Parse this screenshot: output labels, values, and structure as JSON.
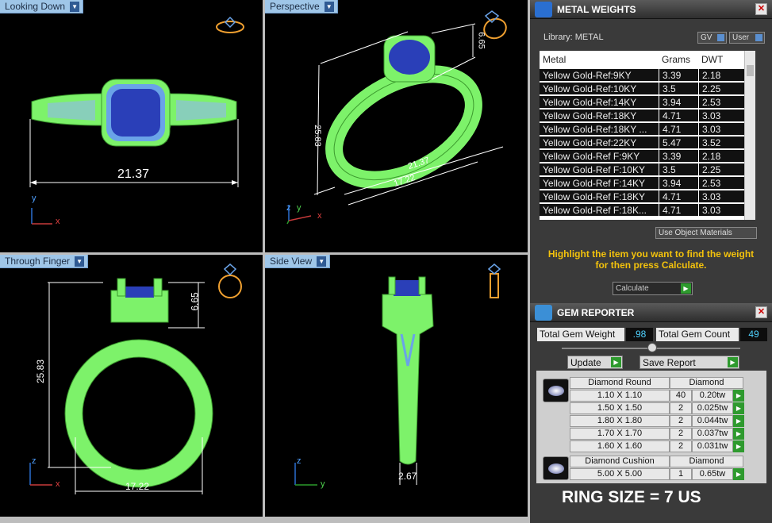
{
  "viewports": {
    "top_left": {
      "title": "Looking Down",
      "dim": "21.37",
      "axis_a": "y",
      "axis_b": "x"
    },
    "top_right": {
      "title": "Perspective",
      "dim_height": "6.65",
      "dim_side": "25.83",
      "dim_width": "21.37",
      "dim_bottom": "17.22",
      "axis_a": "z",
      "axis_b": "y",
      "axis_c": "x"
    },
    "bottom_left": {
      "title": "Through Finger",
      "dim_height": "25.83",
      "dim_top": "6.65",
      "dim_width": "17.22",
      "axis_a": "z",
      "axis_b": "x"
    },
    "bottom_right": {
      "title": "Side View",
      "dim_width": "2.67",
      "axis_a": "z",
      "axis_b": "y"
    }
  },
  "metal_weights": {
    "title": "METAL WEIGHTS",
    "library_label": "Library: METAL",
    "gv_label": "GV",
    "user_label": "User",
    "columns": [
      "Metal",
      "Grams",
      "DWT"
    ],
    "rows": [
      [
        "Yellow Gold-Ref:9KY",
        "3.39",
        "2.18"
      ],
      [
        "Yellow Gold-Ref:10KY",
        "3.5",
        "2.25"
      ],
      [
        "Yellow Gold-Ref:14KY",
        "3.94",
        "2.53"
      ],
      [
        "Yellow Gold-Ref:18KY",
        "4.71",
        "3.03"
      ],
      [
        "Yellow Gold-Ref:18KY ...",
        "4.71",
        "3.03"
      ],
      [
        "Yellow Gold-Ref:22KY",
        "5.47",
        "3.52"
      ],
      [
        "Yellow Gold-Ref F:9KY",
        "3.39",
        "2.18"
      ],
      [
        "Yellow Gold-Ref F:10KY",
        "3.5",
        "2.25"
      ],
      [
        "Yellow Gold-Ref F:14KY",
        "3.94",
        "2.53"
      ],
      [
        "Yellow Gold-Ref F:18KY",
        "4.71",
        "3.03"
      ],
      [
        "Yellow Gold-Ref F:18K...",
        "4.71",
        "3.03"
      ]
    ],
    "use_object_materials": "Use Object Materials",
    "hint": "Highlight the item you want to find the weight for then press Calculate.",
    "calculate_label": "Calculate"
  },
  "gem_reporter": {
    "title": "GEM REPORTER",
    "total_weight_label": "Total Gem Weight",
    "total_weight_value": ".98",
    "total_count_label": "Total Gem Count",
    "total_count_value": "49",
    "update_label": "Update",
    "save_label": "Save Report",
    "groups": [
      {
        "shape": "Diamond Round",
        "material": "Diamond",
        "rows": [
          [
            "1.10 X 1.10",
            "40",
            "0.20tw"
          ],
          [
            "1.50 X 1.50",
            "2",
            "0.025tw"
          ],
          [
            "1.80 X 1.80",
            "2",
            "0.044tw"
          ],
          [
            "1.70 X 1.70",
            "2",
            "0.037tw"
          ],
          [
            "1.60 X 1.60",
            "2",
            "0.031tw"
          ]
        ]
      },
      {
        "shape": "Diamond Cushion",
        "material": "Diamond",
        "rows": [
          [
            "5.00 X 5.00",
            "1",
            "0.65tw"
          ]
        ]
      }
    ]
  },
  "ring_size": "RING SIZE = 7 US",
  "colors": {
    "ring_green": "#7df26a",
    "gem_blue": "#2a3fb8",
    "accent_yellow": "#f3c20c",
    "tab_blue": "#9fc6e8"
  }
}
